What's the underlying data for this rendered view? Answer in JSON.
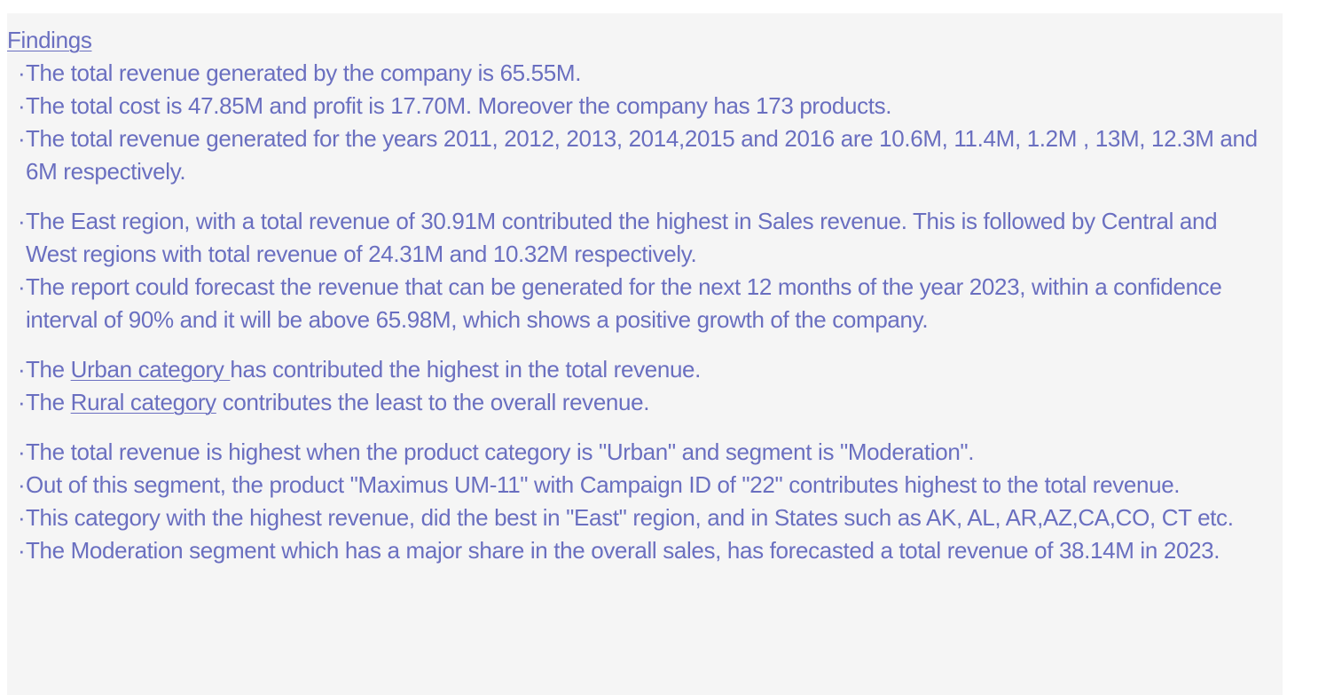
{
  "heading": "Findings",
  "groups": [
    {
      "items": [
        "The total revenue generated by the company is 65.55M.",
        "The total cost is 47.85M and profit is  17.70M. Moreover the company has 173 products.",
        "The total revenue generated for the years 2011, 2012, 2013, 2014,2015 and 2016 are 10.6M, 11.4M, 1.2M , 13M, 12.3M and 6M respectively."
      ]
    },
    {
      "items": [
        "The East region, with a total revenue of 30.91M contributed the highest in Sales revenue. This is followed by Central and West regions with total revenue of 24.31M and 10.32M respectively.",
        "The report could forecast the revenue that can be generated for the next 12 months of the year 2023, within a confidence interval of 90% and it will be above 65.98M, which shows a positive growth of the company."
      ]
    },
    {
      "urban": {
        "prefix": "The ",
        "link": "Urban category ",
        "suffix": "has contributed the highest in the total revenue."
      },
      "rural": {
        "prefix": "The ",
        "link": "Rural category",
        "suffix": " contributes the least to the overall revenue."
      }
    },
    {
      "items": [
        "The total revenue is highest when the product category is \"Urban\" and segment is \"Moderation\".",
        "Out of this segment, the product \"Maximus UM-11\" with Campaign ID of \"22\" contributes highest to the total revenue.",
        "This category with the highest revenue, did the best in \"East\" region, and in States such as AK, AL, AR,AZ,CA,CO, CT etc.",
        " The Moderation segment which has a major share in the overall sales, has forecasted a total revenue of 38.14M in 2023."
      ]
    }
  ],
  "bullet_glyph": "·"
}
